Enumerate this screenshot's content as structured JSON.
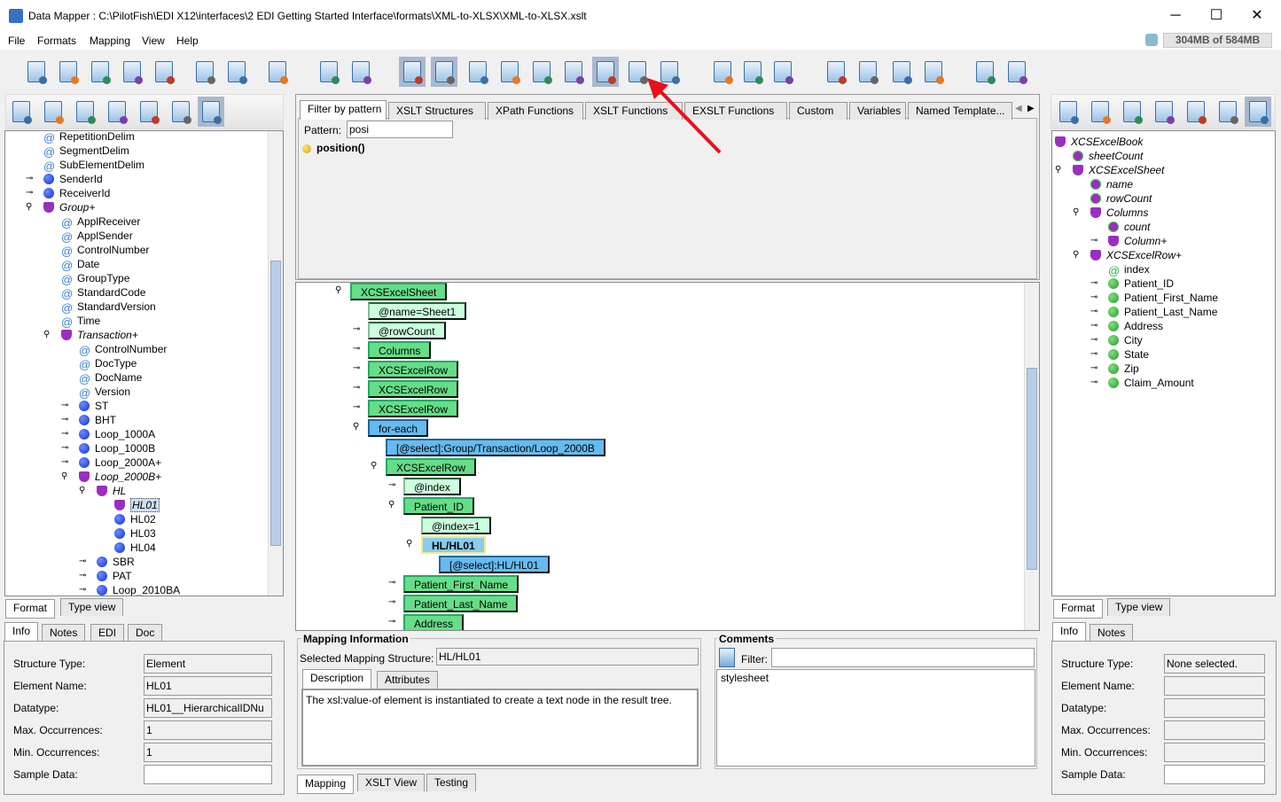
{
  "window": {
    "title": "Data Mapper : C:\\PilotFish\\EDI X12\\interfaces\\2 EDI Getting Started Interface\\formats\\XML-to-XLSX\\XML-to-XLSX.xslt",
    "minimize": "─",
    "maximize": "☐",
    "close": "✕"
  },
  "menu": [
    "File",
    "Formats",
    "Mapping",
    "View",
    "Help"
  ],
  "memory": "304MB of 584MB",
  "toolbar": {
    "main": [
      "new-format",
      "open",
      "save",
      "save-as",
      "new-xls",
      "undo",
      "redo",
      "exit"
    ],
    "mapping": [
      "add-mapping",
      "mapping-settings"
    ],
    "view": [
      "info-view",
      "color-view",
      "checklist",
      "xslt-source",
      "save-clock",
      "wsdl",
      "at-view",
      "table-view",
      "database"
    ],
    "edit": [
      "cut",
      "copy",
      "paste"
    ],
    "tree": [
      "move-up",
      "align",
      "align-2",
      "stack"
    ],
    "help": [
      "help",
      "about"
    ]
  },
  "center_tabs": [
    "Filter by pattern",
    "XSLT Structures",
    "XPath Functions",
    "XSLT Functions",
    "EXSLT Functions",
    "Custom",
    "Variables",
    "Named Template..."
  ],
  "filter": {
    "label": "Pattern:",
    "value": "posi",
    "results": [
      "position()"
    ]
  },
  "left_tree": [
    {
      "t": "RepetitionDelim",
      "d": 0,
      "i": "at"
    },
    {
      "t": "SegmentDelim",
      "d": 0,
      "i": "at"
    },
    {
      "t": "SubElementDelim",
      "d": 0,
      "i": "at"
    },
    {
      "t": "SenderId",
      "d": 0,
      "i": "dot",
      "e": "c"
    },
    {
      "t": "ReceiverId",
      "d": 0,
      "i": "dot",
      "e": "c"
    },
    {
      "t": "Group+",
      "d": 0,
      "i": "v",
      "e": "o",
      "it": true
    },
    {
      "t": "ApplReceiver",
      "d": 1,
      "i": "at"
    },
    {
      "t": "ApplSender",
      "d": 1,
      "i": "at"
    },
    {
      "t": "ControlNumber",
      "d": 1,
      "i": "at"
    },
    {
      "t": "Date",
      "d": 1,
      "i": "at"
    },
    {
      "t": "GroupType",
      "d": 1,
      "i": "at"
    },
    {
      "t": "StandardCode",
      "d": 1,
      "i": "at"
    },
    {
      "t": "StandardVersion",
      "d": 1,
      "i": "at"
    },
    {
      "t": "Time",
      "d": 1,
      "i": "at"
    },
    {
      "t": "Transaction+",
      "d": 1,
      "i": "v",
      "e": "o",
      "it": true
    },
    {
      "t": "ControlNumber",
      "d": 2,
      "i": "at"
    },
    {
      "t": "DocType",
      "d": 2,
      "i": "at"
    },
    {
      "t": "DocName",
      "d": 2,
      "i": "at"
    },
    {
      "t": "Version",
      "d": 2,
      "i": "at"
    },
    {
      "t": "ST",
      "d": 2,
      "i": "dot",
      "e": "c"
    },
    {
      "t": "BHT",
      "d": 2,
      "i": "dot",
      "e": "c"
    },
    {
      "t": "Loop_1000A",
      "d": 2,
      "i": "dot",
      "e": "c"
    },
    {
      "t": "Loop_1000B",
      "d": 2,
      "i": "dot",
      "e": "c"
    },
    {
      "t": "Loop_2000A+",
      "d": 2,
      "i": "dot",
      "e": "c"
    },
    {
      "t": "Loop_2000B+",
      "d": 2,
      "i": "v",
      "e": "o",
      "it": true
    },
    {
      "t": "HL",
      "d": 3,
      "i": "v",
      "e": "o",
      "it": true
    },
    {
      "t": "HL01",
      "d": 4,
      "i": "v",
      "it": true,
      "sel": true
    },
    {
      "t": "HL02",
      "d": 4,
      "i": "dot"
    },
    {
      "t": "HL03",
      "d": 4,
      "i": "dot"
    },
    {
      "t": "HL04",
      "d": 4,
      "i": "dot"
    },
    {
      "t": "SBR",
      "d": 3,
      "i": "dot",
      "e": "c"
    },
    {
      "t": "PAT",
      "d": 3,
      "i": "dot",
      "e": "c"
    },
    {
      "t": "Loop_2010BA",
      "d": 3,
      "i": "dot",
      "e": "c"
    }
  ],
  "right_tree": [
    {
      "t": "XCSExcelBook",
      "d": 0,
      "i": "v",
      "it": true
    },
    {
      "t": "sheetCount",
      "d": 1,
      "i": "vat",
      "it": true
    },
    {
      "t": "XCSExcelSheet",
      "d": 1,
      "i": "v",
      "e": "o",
      "it": true
    },
    {
      "t": "name",
      "d": 2,
      "i": "vat",
      "it": true
    },
    {
      "t": "rowCount",
      "d": 2,
      "i": "vat",
      "it": true
    },
    {
      "t": "Columns",
      "d": 2,
      "i": "v",
      "e": "o",
      "it": true
    },
    {
      "t": "count",
      "d": 3,
      "i": "vat",
      "it": true
    },
    {
      "t": "Column+",
      "d": 3,
      "i": "v",
      "e": "c",
      "it": true
    },
    {
      "t": "XCSExcelRow+",
      "d": 2,
      "i": "v",
      "e": "o",
      "it": true
    },
    {
      "t": "index",
      "d": 3,
      "i": "atg"
    },
    {
      "t": "Patient_ID",
      "d": 3,
      "i": "dotg",
      "e": "c"
    },
    {
      "t": "Patient_First_Name",
      "d": 3,
      "i": "dotg",
      "e": "c"
    },
    {
      "t": "Patient_Last_Name",
      "d": 3,
      "i": "dotg",
      "e": "c"
    },
    {
      "t": "Address",
      "d": 3,
      "i": "dotg",
      "e": "c"
    },
    {
      "t": "City",
      "d": 3,
      "i": "dotg",
      "e": "c"
    },
    {
      "t": "State",
      "d": 3,
      "i": "dotg",
      "e": "c"
    },
    {
      "t": "Zip",
      "d": 3,
      "i": "dotg",
      "e": "c"
    },
    {
      "t": "Claim_Amount",
      "d": 3,
      "i": "dotg",
      "e": "c"
    }
  ],
  "mapping_tree": [
    {
      "t": "XCSExcelSheet",
      "d": 0,
      "k": "el",
      "e": "o"
    },
    {
      "t": "@name=Sheet1",
      "d": 1,
      "k": "attr"
    },
    {
      "t": "@rowCount",
      "d": 1,
      "k": "attr",
      "e": "c"
    },
    {
      "t": "Columns",
      "d": 1,
      "k": "el",
      "e": "c"
    },
    {
      "t": "XCSExcelRow",
      "d": 1,
      "k": "el",
      "e": "c"
    },
    {
      "t": "XCSExcelRow",
      "d": 1,
      "k": "el",
      "e": "c"
    },
    {
      "t": "XCSExcelRow",
      "d": 1,
      "k": "el",
      "e": "c"
    },
    {
      "t": "for-each",
      "d": 1,
      "k": "fe",
      "e": "o"
    },
    {
      "t": "[@select]:Group/Transaction/Loop_2000B",
      "d": 2,
      "k": "fe"
    },
    {
      "t": "XCSExcelRow",
      "d": 2,
      "k": "el",
      "e": "o"
    },
    {
      "t": "@index",
      "d": 3,
      "k": "attr",
      "e": "c"
    },
    {
      "t": "Patient_ID",
      "d": 3,
      "k": "el",
      "e": "o"
    },
    {
      "t": "@index=1",
      "d": 4,
      "k": "attr"
    },
    {
      "t": "HL/HL01",
      "d": 4,
      "k": "cur",
      "e": "o"
    },
    {
      "t": "[@select]:HL/HL01",
      "d": 5,
      "k": "fe"
    },
    {
      "t": "Patient_First_Name",
      "d": 3,
      "k": "el",
      "e": "c"
    },
    {
      "t": "Patient_Last_Name",
      "d": 3,
      "k": "el",
      "e": "c"
    },
    {
      "t": "Address",
      "d": 3,
      "k": "el",
      "e": "c"
    }
  ],
  "left_view_tabs": [
    "Format",
    "Type view"
  ],
  "left_info_tabs": [
    "Info",
    "Notes",
    "EDI",
    "Doc"
  ],
  "left_info": {
    "labels": [
      "Structure Type:",
      "Element Name:",
      "Datatype:",
      "Max. Occurrences:",
      "Min. Occurrences:",
      "Sample Data:"
    ],
    "values": [
      "Element",
      "HL01",
      "HL01__HierarchicalIDNu",
      "1",
      "1",
      ""
    ]
  },
  "right_view_tabs": [
    "Format",
    "Type view"
  ],
  "right_info_tabs": [
    "Info",
    "Notes"
  ],
  "right_info": {
    "labels": [
      "Structure Type:",
      "Element Name:",
      "Datatype:",
      "Max. Occurrences:",
      "Min. Occurrences:",
      "Sample Data:"
    ],
    "values": [
      "None selected.",
      "",
      "",
      "",
      "",
      ""
    ]
  },
  "mapping_info": {
    "title": "Mapping Information",
    "selected_label": "Selected Mapping Structure:",
    "selected_value": "HL/HL01",
    "tabs": [
      "Description",
      "Attributes"
    ],
    "description": "The xsl:value-of element is instantiated to create a text node in the result tree."
  },
  "comments": {
    "title": "Comments",
    "filter_label": "Filter:",
    "filter_value": "",
    "items": [
      "stylesheet"
    ]
  },
  "bottom_tabs": [
    "Mapping",
    "XSLT View",
    "Testing"
  ]
}
